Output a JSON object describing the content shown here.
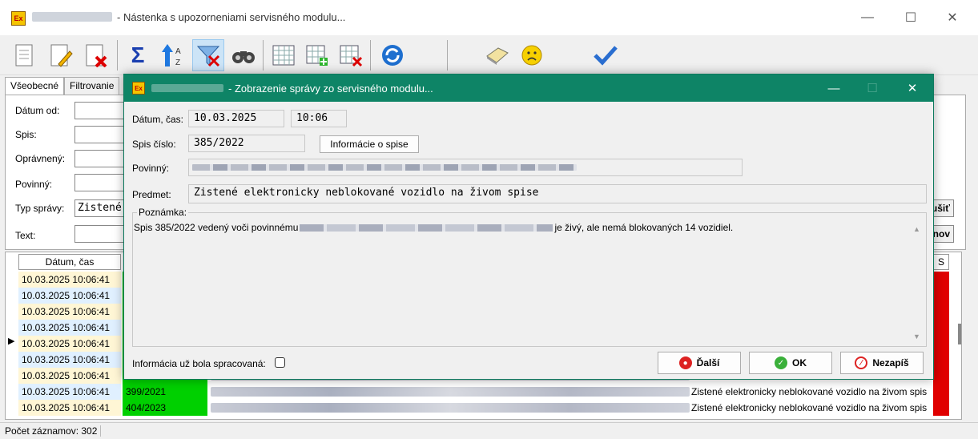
{
  "window": {
    "title": "- Nástenka s upozorneniami servisného modulu...",
    "icon": "app-logo-icon",
    "minimize": "—",
    "maximize": "☐",
    "close": "✕"
  },
  "toolbar": {
    "icons": [
      "new-document-icon",
      "edit-document-icon",
      "delete-document-icon",
      "sum-icon",
      "sort-icon",
      "filter-remove-icon",
      "binoculars-icon",
      "grid-icon",
      "add-row-icon",
      "delete-row-icon",
      "refresh-icon",
      "eraser-icon",
      "sad-face-icon",
      "check-icon"
    ]
  },
  "filter": {
    "tabs": [
      "Všeobecné",
      "Filtrovanie"
    ],
    "labels": {
      "date_from": "Dátum od:",
      "spis": "Spis:",
      "opravneny": "Oprávnený:",
      "povinny": "Povinný:",
      "typ_spravy": "Typ správy:",
      "text": "Text:"
    },
    "typ_spravy_value": "Zistené",
    "side_buttons": [
      "ušiť",
      "nov"
    ]
  },
  "grid": {
    "header_date": "Dátum, čas",
    "header_s": "S",
    "rows": [
      {
        "date": "10.03.2025 10:06:41",
        "spis": "",
        "text": "",
        "bg": "#fff6d5"
      },
      {
        "date": "10.03.2025 10:06:41",
        "spis": "",
        "text": "",
        "bg": "#e0f0ff"
      },
      {
        "date": "10.03.2025 10:06:41",
        "spis": "",
        "text": "",
        "bg": "#fff6d5"
      },
      {
        "date": "10.03.2025 10:06:41",
        "spis": "",
        "text": "",
        "bg": "#e0f0ff"
      },
      {
        "date": "10.03.2025 10:06:41",
        "spis": "",
        "text": "",
        "bg": "#fff6d5"
      },
      {
        "date": "10.03.2025 10:06:41",
        "spis": "",
        "text": "",
        "bg": "#e0f0ff"
      },
      {
        "date": "10.03.2025 10:06:41",
        "spis": "",
        "text": "",
        "bg": "#fff6d5"
      },
      {
        "date": "10.03.2025 10:06:41",
        "spis": "399/2021",
        "text": "Zistené elektronicky neblokované vozidlo na živom spis",
        "bg": "#e0f0ff"
      },
      {
        "date": "10.03.2025 10:06:41",
        "spis": "404/2023",
        "text": "Zistené elektronicky neblokované vozidlo na živom spis",
        "bg": "#fff6d5"
      }
    ]
  },
  "status": {
    "count_text": "Počet záznamov: 302"
  },
  "dialog": {
    "title": "- Zobrazenie správy zo servisného modulu...",
    "date_label": "Dátum, čas:",
    "date_value": "10.03.2025",
    "time_value": "10:06",
    "spis_label": "Spis číslo:",
    "spis_value": "385/2022",
    "spis_info_button": "Informácie o spise",
    "povinny_label": "Povinný:",
    "predmet_label": "Predmet:",
    "predmet_value": "Zistené elektronicky neblokované vozidlo na živom spise",
    "note_label": "Poznámka:",
    "note_text_start": "Spis 385/2022 vedený voči povinnému",
    "note_text_end": "je živý, ale nemá blokovaných 14 vozidiel.",
    "processed_label": "Informácia už bola spracovaná:",
    "btn_next": "Ďalší",
    "btn_ok": "OK",
    "btn_cancel": "Nezapíš",
    "accent": "#0e8466"
  }
}
